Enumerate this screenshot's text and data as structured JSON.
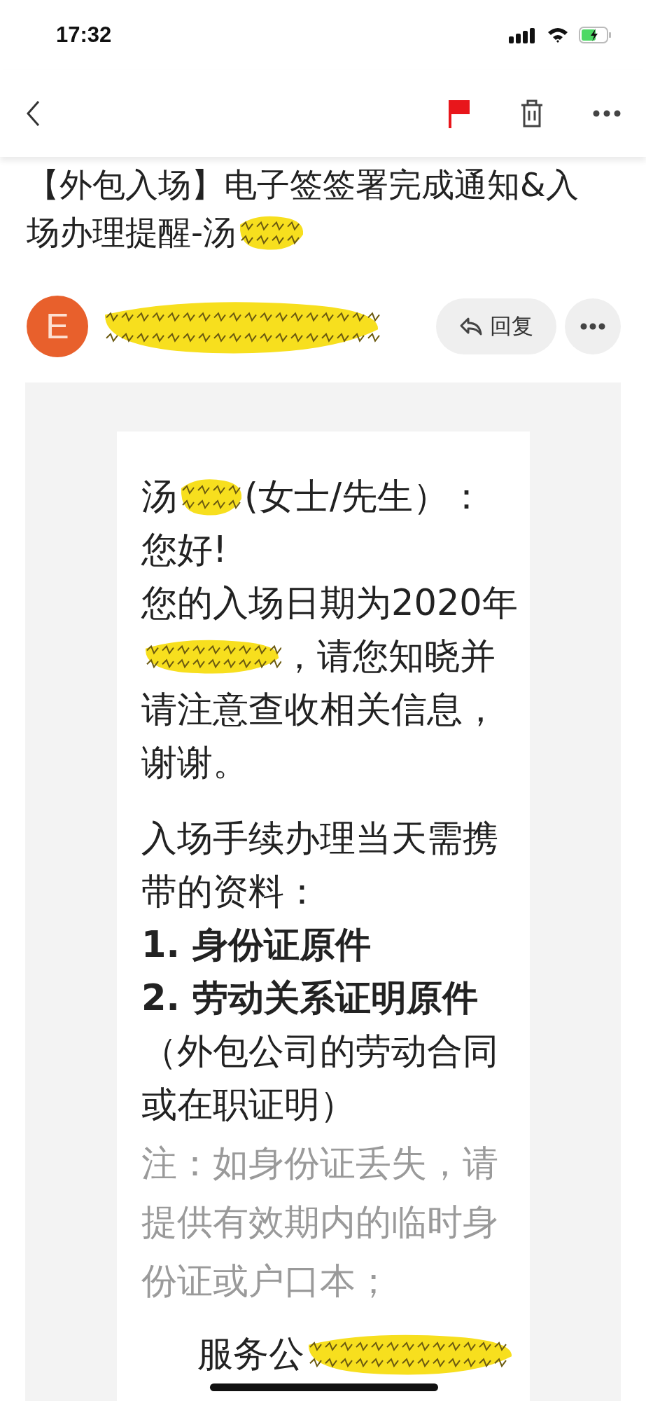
{
  "status_bar": {
    "time": "17:32"
  },
  "subject": {
    "lines": [
      "【外包入场】电子签签署完成通知&入",
      "场办理提醒-汤"
    ],
    "redacted": true
  },
  "sender": {
    "avatar_letter": "E",
    "redacted": true
  },
  "reply_button": {
    "label": "回复"
  },
  "body": [
    {
      "kind": "line",
      "segments": [
        {
          "kind": "text",
          "text": "汤"
        },
        {
          "kind": "redaction"
        },
        {
          "kind": "text",
          "text": "(女士/先生）："
        }
      ]
    },
    {
      "kind": "line",
      "segments": [
        {
          "kind": "text",
          "text": "您好!"
        }
      ]
    },
    {
      "kind": "line",
      "segments": [
        {
          "kind": "text",
          "text": "您的入场日期为2020年"
        }
      ]
    },
    {
      "kind": "line",
      "segments": [
        {
          "kind": "redaction"
        },
        {
          "kind": "text",
          "text": "，请您知晓并"
        }
      ]
    },
    {
      "kind": "line",
      "segments": [
        {
          "kind": "text",
          "text": "请注意查收相关信息，"
        }
      ]
    },
    {
      "kind": "line",
      "segments": [
        {
          "kind": "text",
          "text": "谢谢。"
        }
      ]
    },
    {
      "kind": "blank"
    },
    {
      "kind": "line",
      "segments": [
        {
          "kind": "text",
          "text": "入场手续办理当天需携"
        }
      ]
    },
    {
      "kind": "line",
      "segments": [
        {
          "kind": "text",
          "text": "带的资料："
        }
      ]
    },
    {
      "kind": "bold",
      "segments": [
        {
          "kind": "text",
          "text": "1. 身份证原件"
        }
      ]
    },
    {
      "kind": "bold",
      "segments": [
        {
          "kind": "text",
          "text": "2. 劳动关系证明原件"
        }
      ]
    },
    {
      "kind": "line",
      "segments": [
        {
          "kind": "text",
          "text": "（外包公司的劳动合同"
        }
      ]
    },
    {
      "kind": "line",
      "segments": [
        {
          "kind": "text",
          "text": "或在职证明）"
        }
      ]
    },
    {
      "kind": "note",
      "segments": [
        {
          "kind": "text",
          "text": "注：如身份证丢失，请"
        }
      ]
    },
    {
      "kind": "note",
      "segments": [
        {
          "kind": "text",
          "text": "提供有效期内的临时身"
        }
      ]
    },
    {
      "kind": "note",
      "segments": [
        {
          "kind": "text",
          "text": "份证或户口本；"
        }
      ]
    },
    {
      "kind": "signature",
      "segments": [
        {
          "kind": "text",
          "text": "服务公"
        },
        {
          "kind": "redaction"
        }
      ]
    }
  ]
}
